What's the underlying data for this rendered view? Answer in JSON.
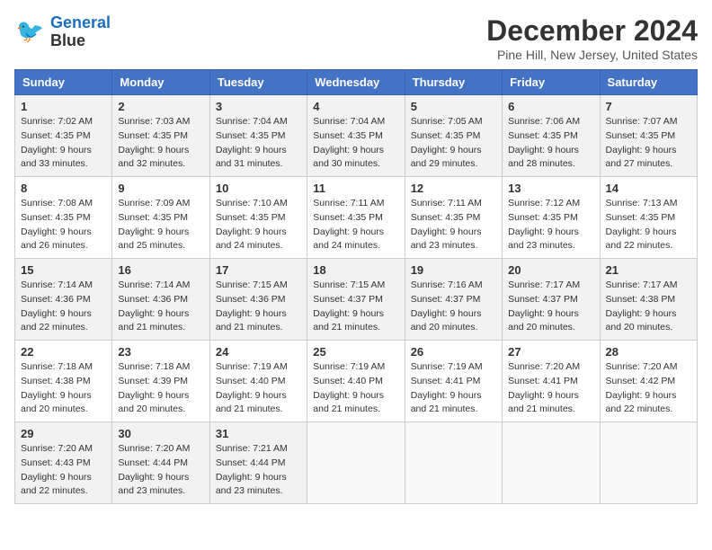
{
  "logo": {
    "line1": "General",
    "line2": "Blue"
  },
  "title": "December 2024",
  "location": "Pine Hill, New Jersey, United States",
  "days_of_week": [
    "Sunday",
    "Monday",
    "Tuesday",
    "Wednesday",
    "Thursday",
    "Friday",
    "Saturday"
  ],
  "weeks": [
    [
      {
        "day": "1",
        "sunrise": "7:02 AM",
        "sunset": "4:35 PM",
        "daylight": "9 hours and 33 minutes."
      },
      {
        "day": "2",
        "sunrise": "7:03 AM",
        "sunset": "4:35 PM",
        "daylight": "9 hours and 32 minutes."
      },
      {
        "day": "3",
        "sunrise": "7:04 AM",
        "sunset": "4:35 PM",
        "daylight": "9 hours and 31 minutes."
      },
      {
        "day": "4",
        "sunrise": "7:04 AM",
        "sunset": "4:35 PM",
        "daylight": "9 hours and 30 minutes."
      },
      {
        "day": "5",
        "sunrise": "7:05 AM",
        "sunset": "4:35 PM",
        "daylight": "9 hours and 29 minutes."
      },
      {
        "day": "6",
        "sunrise": "7:06 AM",
        "sunset": "4:35 PM",
        "daylight": "9 hours and 28 minutes."
      },
      {
        "day": "7",
        "sunrise": "7:07 AM",
        "sunset": "4:35 PM",
        "daylight": "9 hours and 27 minutes."
      }
    ],
    [
      {
        "day": "8",
        "sunrise": "7:08 AM",
        "sunset": "4:35 PM",
        "daylight": "9 hours and 26 minutes."
      },
      {
        "day": "9",
        "sunrise": "7:09 AM",
        "sunset": "4:35 PM",
        "daylight": "9 hours and 25 minutes."
      },
      {
        "day": "10",
        "sunrise": "7:10 AM",
        "sunset": "4:35 PM",
        "daylight": "9 hours and 24 minutes."
      },
      {
        "day": "11",
        "sunrise": "7:11 AM",
        "sunset": "4:35 PM",
        "daylight": "9 hours and 24 minutes."
      },
      {
        "day": "12",
        "sunrise": "7:11 AM",
        "sunset": "4:35 PM",
        "daylight": "9 hours and 23 minutes."
      },
      {
        "day": "13",
        "sunrise": "7:12 AM",
        "sunset": "4:35 PM",
        "daylight": "9 hours and 23 minutes."
      },
      {
        "day": "14",
        "sunrise": "7:13 AM",
        "sunset": "4:35 PM",
        "daylight": "9 hours and 22 minutes."
      }
    ],
    [
      {
        "day": "15",
        "sunrise": "7:14 AM",
        "sunset": "4:36 PM",
        "daylight": "9 hours and 22 minutes."
      },
      {
        "day": "16",
        "sunrise": "7:14 AM",
        "sunset": "4:36 PM",
        "daylight": "9 hours and 21 minutes."
      },
      {
        "day": "17",
        "sunrise": "7:15 AM",
        "sunset": "4:36 PM",
        "daylight": "9 hours and 21 minutes."
      },
      {
        "day": "18",
        "sunrise": "7:15 AM",
        "sunset": "4:37 PM",
        "daylight": "9 hours and 21 minutes."
      },
      {
        "day": "19",
        "sunrise": "7:16 AM",
        "sunset": "4:37 PM",
        "daylight": "9 hours and 20 minutes."
      },
      {
        "day": "20",
        "sunrise": "7:17 AM",
        "sunset": "4:37 PM",
        "daylight": "9 hours and 20 minutes."
      },
      {
        "day": "21",
        "sunrise": "7:17 AM",
        "sunset": "4:38 PM",
        "daylight": "9 hours and 20 minutes."
      }
    ],
    [
      {
        "day": "22",
        "sunrise": "7:18 AM",
        "sunset": "4:38 PM",
        "daylight": "9 hours and 20 minutes."
      },
      {
        "day": "23",
        "sunrise": "7:18 AM",
        "sunset": "4:39 PM",
        "daylight": "9 hours and 20 minutes."
      },
      {
        "day": "24",
        "sunrise": "7:19 AM",
        "sunset": "4:40 PM",
        "daylight": "9 hours and 21 minutes."
      },
      {
        "day": "25",
        "sunrise": "7:19 AM",
        "sunset": "4:40 PM",
        "daylight": "9 hours and 21 minutes."
      },
      {
        "day": "26",
        "sunrise": "7:19 AM",
        "sunset": "4:41 PM",
        "daylight": "9 hours and 21 minutes."
      },
      {
        "day": "27",
        "sunrise": "7:20 AM",
        "sunset": "4:41 PM",
        "daylight": "9 hours and 21 minutes."
      },
      {
        "day": "28",
        "sunrise": "7:20 AM",
        "sunset": "4:42 PM",
        "daylight": "9 hours and 22 minutes."
      }
    ],
    [
      {
        "day": "29",
        "sunrise": "7:20 AM",
        "sunset": "4:43 PM",
        "daylight": "9 hours and 22 minutes."
      },
      {
        "day": "30",
        "sunrise": "7:20 AM",
        "sunset": "4:44 PM",
        "daylight": "9 hours and 23 minutes."
      },
      {
        "day": "31",
        "sunrise": "7:21 AM",
        "sunset": "4:44 PM",
        "daylight": "9 hours and 23 minutes."
      },
      null,
      null,
      null,
      null
    ]
  ],
  "labels": {
    "sunrise": "Sunrise:",
    "sunset": "Sunset:",
    "daylight": "Daylight:"
  }
}
